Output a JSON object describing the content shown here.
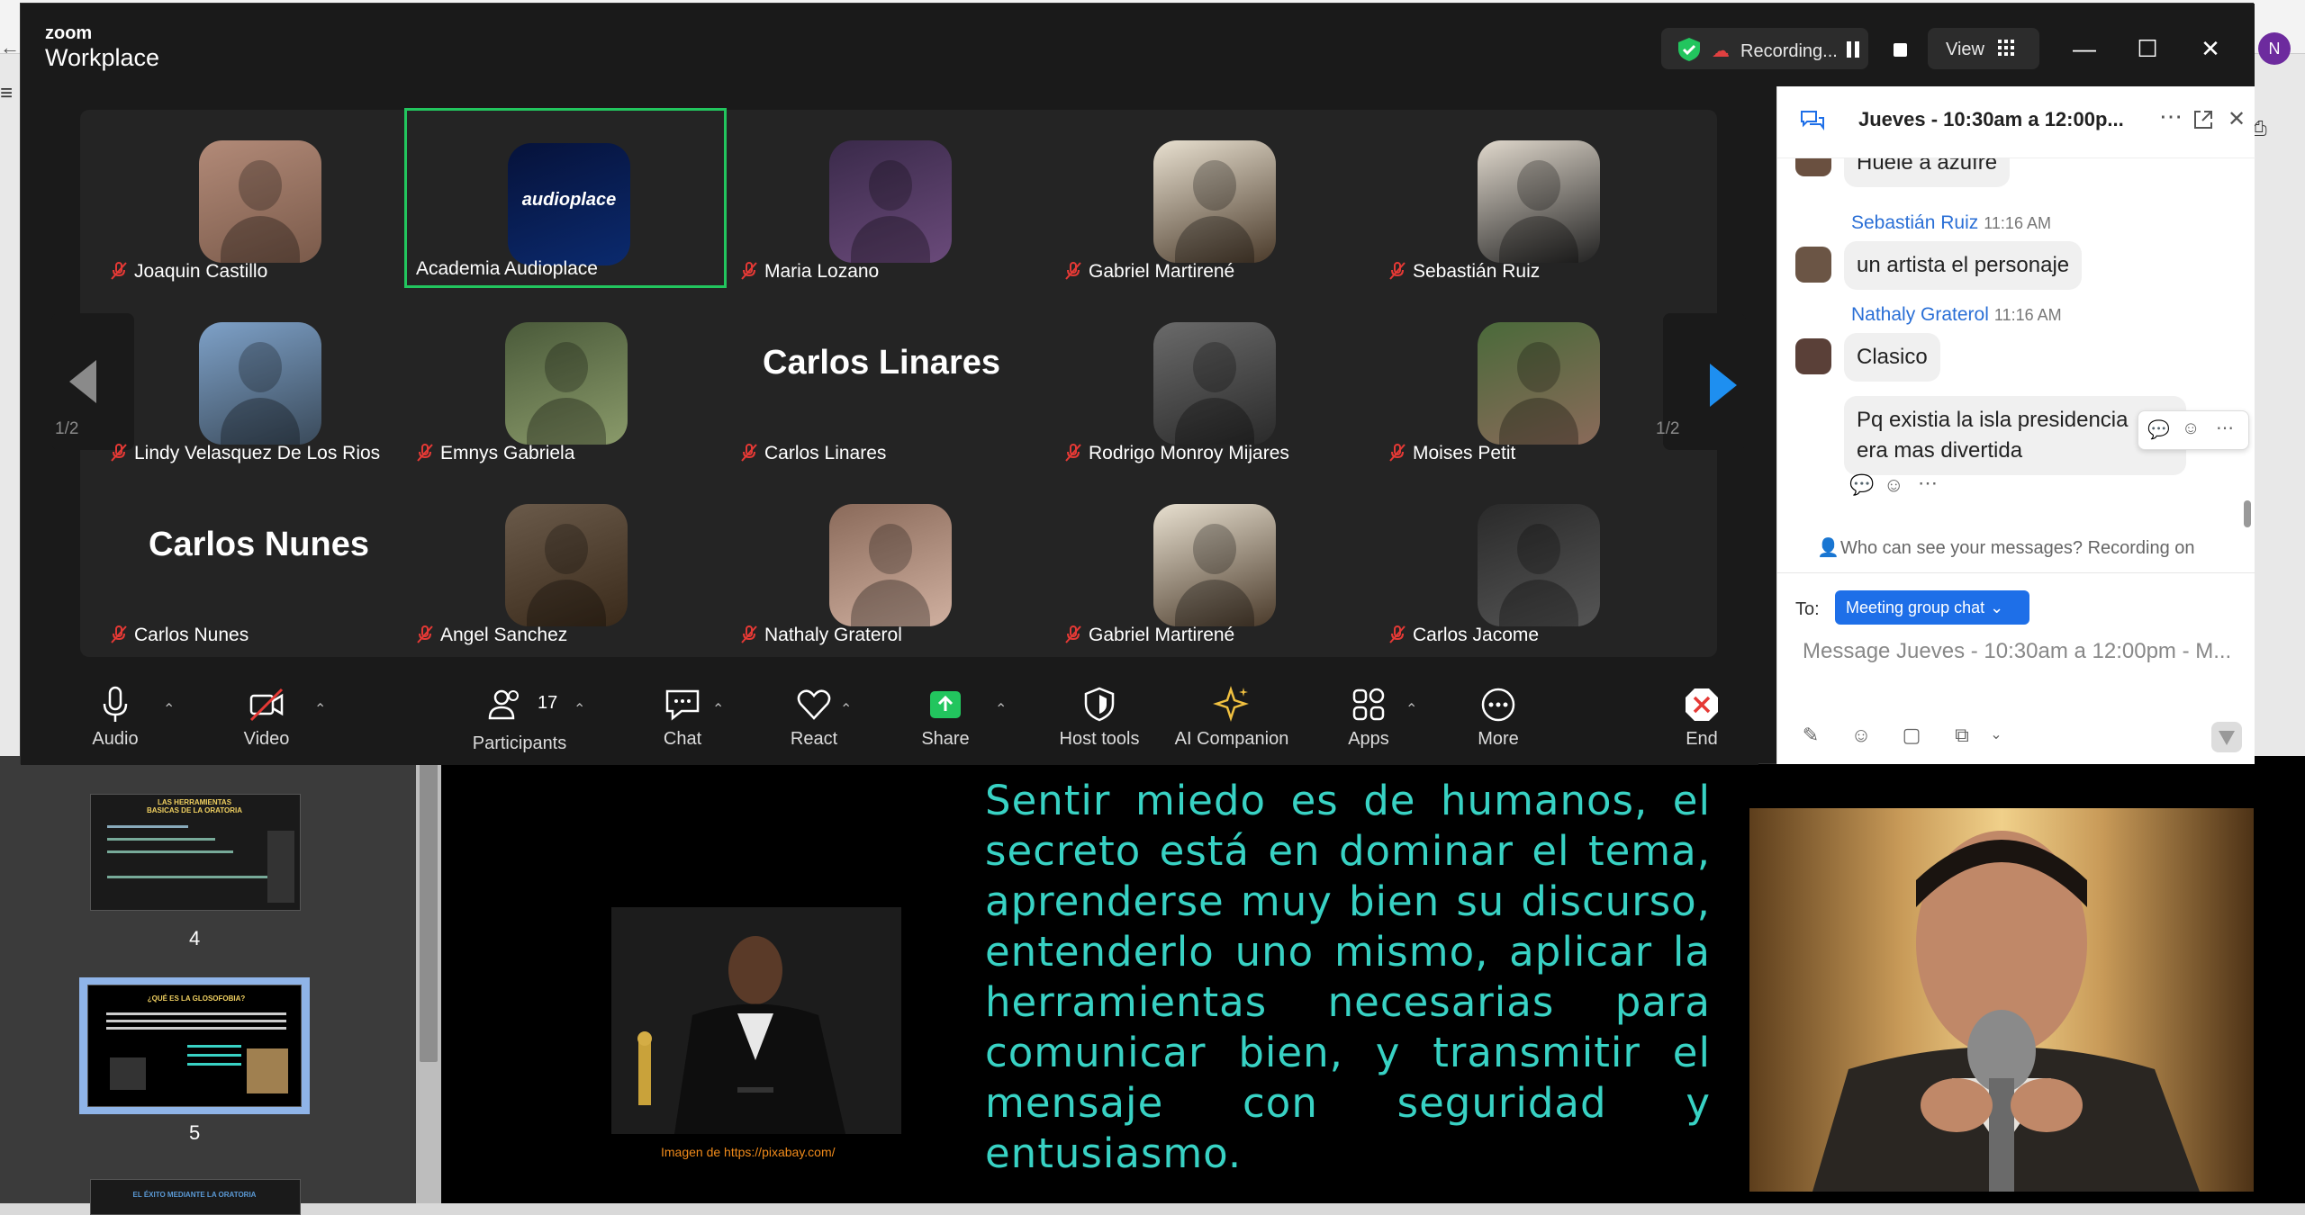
{
  "app": {
    "logo_small": "zoom",
    "logo_big": "Workplace",
    "recording_label": "Recording...",
    "view_label": "View",
    "user_initial": "N"
  },
  "gallery": {
    "page_left": "1/2",
    "page_right": "1/2",
    "participants": [
      {
        "name": "Joaquin Castillo",
        "muted": true,
        "type": "photo"
      },
      {
        "name": "Academia Audioplace",
        "muted": false,
        "type": "logo",
        "logo_text": "audioplace",
        "active": true
      },
      {
        "name": "Maria Lozano",
        "muted": true,
        "type": "photo"
      },
      {
        "name": "Gabriel Martirené",
        "muted": true,
        "type": "photo"
      },
      {
        "name": "Sebastián Ruiz",
        "muted": true,
        "type": "photo"
      },
      {
        "name": "Lindy Velasquez De Los Rios",
        "muted": true,
        "type": "photo"
      },
      {
        "name": "Emnys Gabriela",
        "muted": true,
        "type": "photo"
      },
      {
        "name": "Carlos Linares",
        "muted": true,
        "type": "text",
        "big_name": "Carlos Linares"
      },
      {
        "name": "Rodrigo Monroy Mijares",
        "muted": true,
        "type": "photo"
      },
      {
        "name": "Moises Petit",
        "muted": true,
        "type": "photo"
      },
      {
        "name": "Carlos Nunes",
        "muted": true,
        "type": "text",
        "big_name": "Carlos Nunes"
      },
      {
        "name": "Angel Sanchez",
        "muted": true,
        "type": "photo"
      },
      {
        "name": "Nathaly Graterol",
        "muted": true,
        "type": "photo"
      },
      {
        "name": "Gabriel Martirené",
        "muted": true,
        "type": "photo"
      },
      {
        "name": "Carlos Jacome",
        "muted": true,
        "type": "photo"
      }
    ]
  },
  "toolbar": {
    "audio": "Audio",
    "video": "Video",
    "participants": "Participants",
    "participants_count": "17",
    "chat": "Chat",
    "react": "React",
    "share": "Share",
    "host_tools": "Host tools",
    "ai_companion": "AI Companion",
    "apps": "Apps",
    "more": "More",
    "end": "End"
  },
  "chat": {
    "title": "Jueves - 10:30am a 12:00p...",
    "partial_top": "Huele a azufre",
    "messages": [
      {
        "sender": "Sebastián Ruiz",
        "time": "11:16 AM",
        "texts": [
          "un artista el personaje"
        ]
      },
      {
        "sender": "Nathaly Graterol",
        "time": "11:16 AM",
        "texts": [
          "Clasico",
          "Pq existia la isla presidencial era mas divertida"
        ]
      }
    ],
    "message_line1": "Pq existia la isla presidencia",
    "message_line2": "era mas divertida",
    "privacy": "Who can see your messages? Recording on",
    "to_label": "To:",
    "to_value": "Meeting group chat",
    "input_placeholder": "Message Jueves - 10:30am a 12:00pm - M..."
  },
  "slides": {
    "thumb_4_number": "4",
    "thumb_5_number": "5",
    "thumb_4_title": "LAS HERRAMIENTAS BASICAS DE LA ORATORIA",
    "thumb_5_title": "¿QUÉ ES LA GLOSOFOBIA?",
    "thumb_6_title": "EL ÉXITO MEDIANTE LA ORATORIA"
  },
  "slide": {
    "text": "Sentir miedo es de humanos, el secreto está en dominar el tema, aprenderse muy bien su discurso, entenderlo uno mismo, aplicar la herramientas necesarias para comunicar bien, y transmitir el mensaje con seguridad y entusiasmo.",
    "caption": "Imagen de https://pixabay.com/"
  },
  "colors": {
    "active_border": "#22c55e",
    "accent_blue": "#1e6fe8",
    "slide_text": "#38d2c4",
    "recording_red": "#e04040"
  }
}
